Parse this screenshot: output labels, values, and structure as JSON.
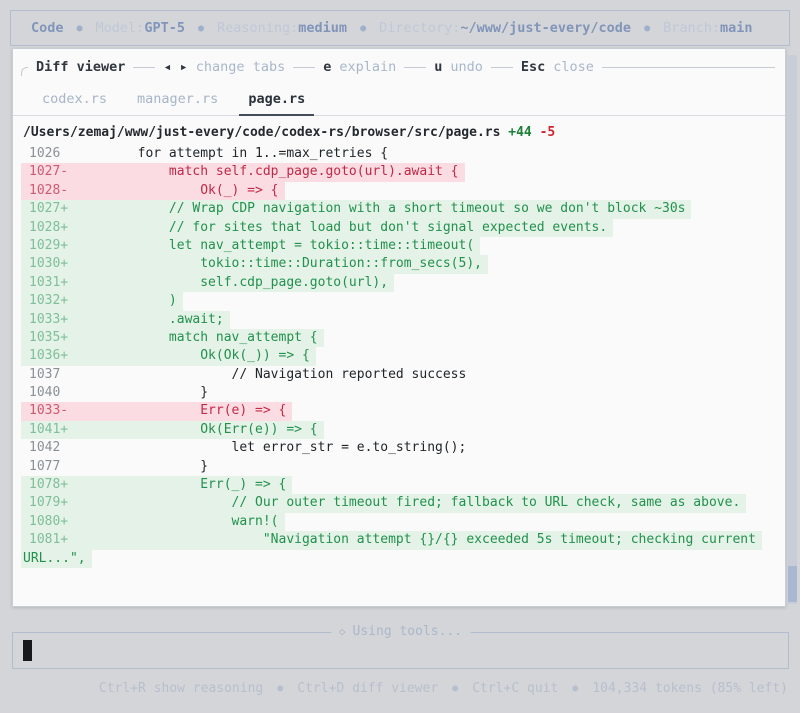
{
  "header": {
    "app": "Code",
    "separator": "●",
    "items": [
      {
        "label": "Model:",
        "value": "GPT-5"
      },
      {
        "label": "Reasoning:",
        "value": "medium"
      },
      {
        "label": "Directory:",
        "value": "~/www/just-every/code"
      },
      {
        "label": "Branch:",
        "value": "main"
      }
    ]
  },
  "diff_viewer": {
    "title": "Diff viewer",
    "hints": [
      {
        "key": "◂ ▸",
        "label": "change tabs"
      },
      {
        "key": "e",
        "label": "explain"
      },
      {
        "key": "u",
        "label": "undo"
      },
      {
        "key": "Esc",
        "label": "close"
      }
    ],
    "tabs": [
      {
        "label": "codex.rs",
        "active": false
      },
      {
        "label": "manager.rs",
        "active": false
      },
      {
        "label": "page.rs",
        "active": true
      }
    ],
    "file": {
      "path": "/Users/zemaj/www/just-every/code/codex-rs/browser/src/page.rs",
      "additions": "+44",
      "deletions": "-5"
    },
    "lines": [
      {
        "num": "1026",
        "type": "ctx",
        "code": "        for attempt in 1..=max_retries {"
      },
      {
        "num": "1027-",
        "type": "del",
        "code": "            match self.cdp_page.goto(url).await {"
      },
      {
        "num": "1028-",
        "type": "del",
        "code": "                Ok(_) => {"
      },
      {
        "num": "1027+",
        "type": "add",
        "code": "            // Wrap CDP navigation with a short timeout so we don't block ~30s"
      },
      {
        "num": "1028+",
        "type": "add",
        "code": "            // for sites that load but don't signal expected events."
      },
      {
        "num": "1029+",
        "type": "add",
        "code": "            let nav_attempt = tokio::time::timeout("
      },
      {
        "num": "1030+",
        "type": "add",
        "code": "                tokio::time::Duration::from_secs(5),"
      },
      {
        "num": "1031+",
        "type": "add",
        "code": "                self.cdp_page.goto(url),"
      },
      {
        "num": "1032+",
        "type": "add",
        "code": "            )"
      },
      {
        "num": "1033+",
        "type": "add",
        "code": "            .await;"
      },
      {
        "num": "1035+",
        "type": "add",
        "code": "            match nav_attempt {"
      },
      {
        "num": "1036+",
        "type": "add",
        "code": "                Ok(Ok(_)) => {"
      },
      {
        "num": "1037",
        "type": "ctx",
        "code": "                    // Navigation reported success"
      },
      {
        "num": "1040",
        "type": "ctx",
        "code": "                }"
      },
      {
        "num": "1033-",
        "type": "del",
        "code": "                Err(e) => {"
      },
      {
        "num": "1041+",
        "type": "add",
        "code": "                Ok(Err(e)) => {"
      },
      {
        "num": "1042",
        "type": "ctx",
        "code": "                    let error_str = e.to_string();"
      },
      {
        "num": "1077",
        "type": "ctx",
        "code": "                }"
      },
      {
        "num": "1078+",
        "type": "add",
        "code": "                Err(_) => {"
      },
      {
        "num": "1079+",
        "type": "add",
        "code": "                    // Our outer timeout fired; fallback to URL check, same as above."
      },
      {
        "num": "1080+",
        "type": "add",
        "code": "                    warn!("
      },
      {
        "num": "1081+",
        "type": "add",
        "code": "                        \"Navigation attempt {}/{} exceeded 5s timeout; checking current"
      },
      {
        "num": "",
        "type": "add",
        "wrap": true,
        "code": "URL...\","
      }
    ]
  },
  "composer": {
    "diamond": "◇",
    "status": "Using tools..."
  },
  "footer": {
    "separator": "●",
    "items": [
      "Ctrl+R show reasoning",
      "Ctrl+D diff viewer",
      "Ctrl+C quit",
      "104,334 tokens (85% left)"
    ]
  },
  "colors": {
    "page_bg": "#d4d5d8",
    "panel_bg": "#fafafa",
    "accent_blue": "#8195ba",
    "muted_blue": "#bfc8d8",
    "addition_bg": "#e4f2e8",
    "addition_fg": "#22914d",
    "deletion_bg": "#fadce2",
    "deletion_fg": "#c02946",
    "additions_count_fg": "#1a7f37",
    "deletions_count_fg": "#cf222e"
  }
}
